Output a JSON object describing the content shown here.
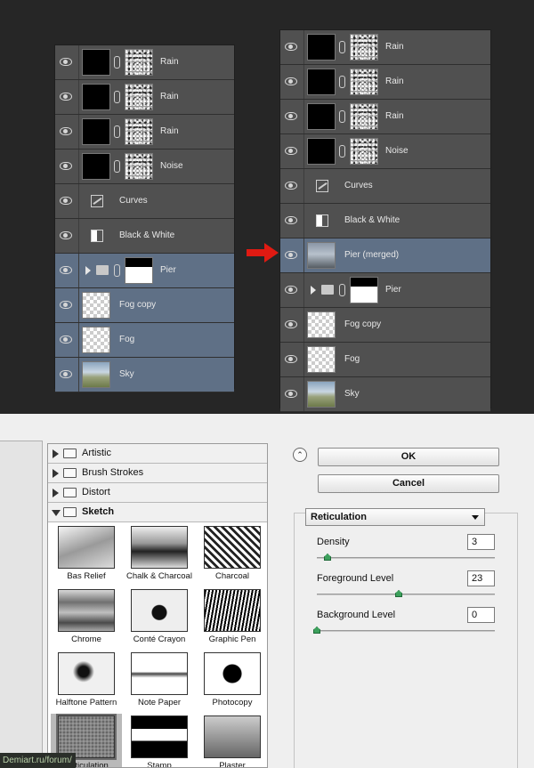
{
  "layers_before": [
    {
      "name": "Rain",
      "thumb": "black",
      "mask": "noise"
    },
    {
      "name": "Rain",
      "thumb": "black",
      "mask": "noise"
    },
    {
      "name": "Rain",
      "thumb": "black",
      "mask": "noise"
    },
    {
      "name": "Noise",
      "thumb": "black",
      "mask": "noise"
    },
    {
      "name": "Curves",
      "icon": "curves-icon"
    },
    {
      "name": "Black & White",
      "icon": "black-white-icon"
    },
    {
      "name": "Pier",
      "group": true,
      "selected": true
    },
    {
      "name": "Fog copy",
      "thumb": "checker",
      "selected": true
    },
    {
      "name": "Fog",
      "thumb": "checker",
      "selected": true
    },
    {
      "name": "Sky",
      "thumb": "sky",
      "selected": true
    }
  ],
  "layers_after": [
    {
      "name": "Rain",
      "thumb": "black",
      "mask": "noise"
    },
    {
      "name": "Rain",
      "thumb": "black",
      "mask": "noise"
    },
    {
      "name": "Rain",
      "thumb": "black",
      "mask": "noise"
    },
    {
      "name": "Noise",
      "thumb": "black",
      "mask": "noise"
    },
    {
      "name": "Curves",
      "icon": "curves-icon"
    },
    {
      "name": "Black & White",
      "icon": "black-white-icon"
    },
    {
      "name": "Pier (merged)",
      "thumb": "merged",
      "selected": true
    },
    {
      "name": "Pier",
      "group": true
    },
    {
      "name": "Fog copy",
      "thumb": "checker"
    },
    {
      "name": "Fog",
      "thumb": "checker"
    },
    {
      "name": "Sky",
      "thumb": "sky"
    }
  ],
  "arrow_color": "#e01a12",
  "selection_color": "#5f7086",
  "filter_gallery": {
    "categories": [
      "Artistic",
      "Brush Strokes",
      "Distort",
      "Sketch"
    ],
    "open_category": "Sketch",
    "filters": [
      "Bas Relief",
      "Chalk & Charcoal",
      "Charcoal",
      "Chrome",
      "Conté Crayon",
      "Graphic Pen",
      "Halftone Pattern",
      "Note Paper",
      "Photocopy",
      "Reticulation",
      "Stamp",
      "Plaster"
    ],
    "selected_filter": "Reticulation"
  },
  "controls": {
    "ok_label": "OK",
    "cancel_label": "Cancel",
    "filter_select": "Reticulation",
    "density_label": "Density",
    "density_value": "3",
    "density_fraction": 0.06,
    "foreground_label": "Foreground Level",
    "foreground_value": "23",
    "foreground_fraction": 0.46,
    "background_label": "Background Level",
    "background_value": "0",
    "background_fraction": 0.0
  },
  "watermark": "Demiart.ru/forum/"
}
